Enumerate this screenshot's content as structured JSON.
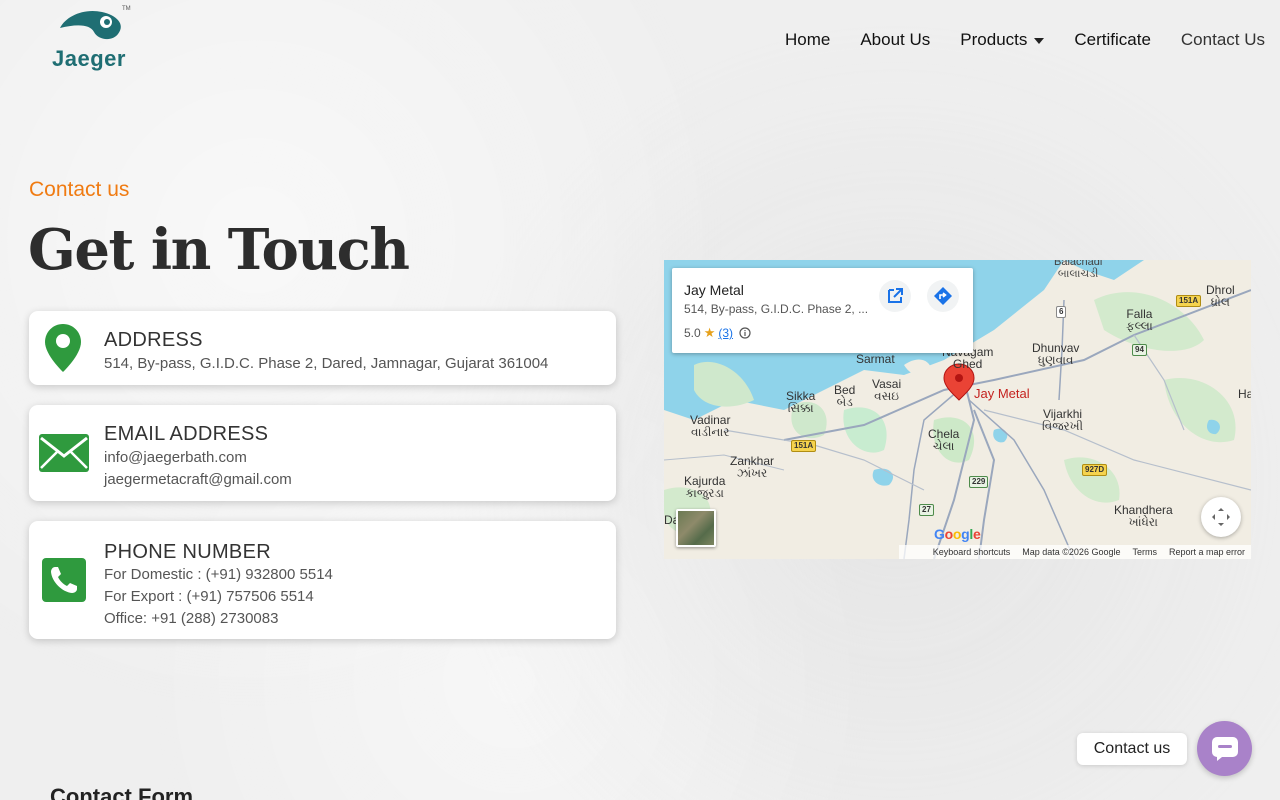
{
  "header": {
    "logo_text": "Jaeger",
    "logo_tm": "TM",
    "nav": [
      {
        "label": "Home"
      },
      {
        "label": "About Us"
      },
      {
        "label": "Products"
      },
      {
        "label": "Certificate"
      },
      {
        "label": "Contact Us"
      }
    ]
  },
  "section": {
    "eyebrow": "Contact us",
    "title": "Get in Touch"
  },
  "cards": {
    "address": {
      "heading": "ADDRESS",
      "line1": "514, By-pass, G.I.D.C. Phase 2, Dared, Jamnagar, Gujarat 361004"
    },
    "email": {
      "heading": "EMAIL ADDRESS",
      "line1": "info@jaegerbath.com",
      "line2": "jaegermetacraft@gmail.com"
    },
    "phone": {
      "heading": "PHONE NUMBER",
      "line1": "For Domestic : (+91) 932800 5514",
      "line2": "For Export : (+91) 757506 5514",
      "line3": "Office: +91 (288) 2730083"
    }
  },
  "map": {
    "info_title": "Jay Metal",
    "info_address": "514, By-pass, G.I.D.C. Phase 2, ...",
    "rating": "5.0",
    "review_count": "(3)",
    "pin_label": "Jay Metal",
    "google": "Google",
    "footer": {
      "shortcuts": "Keyboard shortcuts",
      "data": "Map data ©2026 Google",
      "terms": "Terms",
      "report": "Report a map error"
    },
    "places": {
      "balachadi": "Balachadi",
      "balachadi_gu": "બાલાચડી",
      "dhrol": "Dhrol",
      "dhrol_gu": "ધ્રોલ",
      "falla": "Falla",
      "falla_gu": "ફલ્લા",
      "sarmat": "Sarmat",
      "navagam": "Navagam",
      "ghed": "Ghed",
      "dhunvav": "Dhunvav",
      "dhunvav_gu": "ધુણવાવ",
      "sikka": "Sikka",
      "sikka_gu": "સિક્કા",
      "bed": "Bed",
      "bed_gu": "બેડ",
      "vasai": "Vasai",
      "vasai_gu": "વસઇ",
      "vadinar": "Vadinar",
      "vadinar_gu": "વાડીનાર",
      "vijarkhi": "Vijarkhi",
      "vijarkhi_gu": "વિજરખી",
      "chela": "Chela",
      "chela_gu": "ચેલા",
      "zankhar": "Zankhar",
      "zankhar_gu": "ઝાંખર",
      "kajurda": "Kajurda",
      "kajurda_gu": "કાજુરડા",
      "khandhera": "Khandhera",
      "khandhera_gu": "ખાંધેરા",
      "ha": "Ha",
      "da": "Da"
    },
    "shields": {
      "r6": "6",
      "r151a_top": "151A",
      "r94": "94",
      "r151a_mid": "151A",
      "r927d": "927D",
      "r229": "229",
      "r27": "27"
    }
  },
  "widget": {
    "bubble": "Contact us"
  },
  "form": {
    "title": "Contact Form"
  },
  "colors": {
    "accent": "#f07b12",
    "icon_green": "#2f9a3e",
    "brand_teal": "#1f6e73",
    "widget_purple": "#a982c9"
  }
}
